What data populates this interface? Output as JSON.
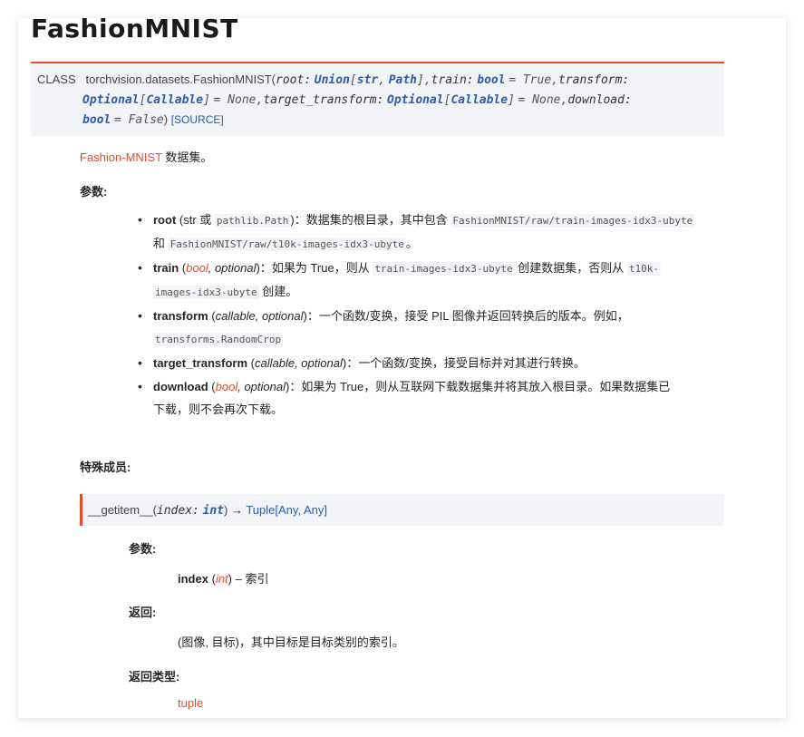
{
  "title": "FashionMNIST",
  "signature": {
    "class_label": "CLASS",
    "class_path": "torchvision.datasets.FashionMNIST(",
    "p_root": "root:",
    "t_union": "Union",
    "lb1": "[",
    "t_str": "str",
    "comma1": ",",
    "t_path": "Path",
    "rb1": "]",
    "sep1": ",",
    "p_train": "train:",
    "t_bool1": "bool",
    "d_true": "= True",
    "sep2": ",",
    "p_transform": "transform:",
    "t_optional1": "Optional",
    "lb2": "[",
    "t_callable1": "Callable",
    "rb2": "]",
    "d_none1": "= None",
    "sep3": ",",
    "p_target": "target_transform:",
    "t_optional2": "Optional",
    "lb3": "[",
    "t_callable2": "Callable",
    "rb3": "]",
    "d_none2": "= None",
    "sep4": ",",
    "p_download": "download:",
    "t_bool2": "bool",
    "d_false": "= False",
    "close": ")",
    "source": "[SOURCE]"
  },
  "description": {
    "link": "Fashion-MNIST",
    "text": "数据集。"
  },
  "params_heading": "参数:",
  "params": {
    "root": {
      "name": "root",
      "open": "(str 或 ",
      "code1": "pathlib.Path",
      "close": ")",
      "desc": "：数据集的根目录，其中包含 ",
      "code2": "FashionMNIST/raw/train-images-idx3-ubyte",
      "and": "和 ",
      "code3": "FashionMNIST/raw/t10k-images-idx3-ubyte",
      "end": "。"
    },
    "train": {
      "name": "train",
      "open": "(",
      "type": "bool",
      "opt": ", optional",
      "close": ")",
      "desc": "：如果为 True，则从 ",
      "code1": "train-images-idx3-ubyte",
      "mid": " 创建数据集，否则从 ",
      "code2a": "t10k-",
      "code2b": "images-idx3-ubyte",
      "end": " 创建。"
    },
    "transform": {
      "name": "transform",
      "open": "(",
      "type": "callable, optional",
      "close": ")",
      "desc": "：一个函数/变换，接受 PIL 图像并返回转换后的版本。例如，",
      "code1": "transforms.RandomCrop"
    },
    "target_transform": {
      "name": "target_transform",
      "open": "(",
      "type": "callable, optional",
      "close": ")",
      "desc": "：一个函数/变换，接受目标并对其进行转换。"
    },
    "download": {
      "name": "download",
      "open": "(",
      "type": "bool",
      "opt": ", optional",
      "close": ")",
      "desc": "：如果为 True，则从互联网下载数据集并将其放入根目录。如果数据集已",
      "desc2": "下载，则不会再次下载。"
    }
  },
  "special_members_heading": "特殊成员:",
  "method": {
    "name": "__getitem__",
    "open": "(",
    "param": "index:",
    "ptype": "int",
    "close": ")",
    "arrow": "→",
    "ret": "Tuple",
    "ret_open": "[",
    "any1": "Any",
    "comma": ", ",
    "any2": "Any",
    "ret_close": "]"
  },
  "method_params_heading": "参数:",
  "method_param": {
    "name": "index",
    "open": "(",
    "type": "int",
    "close": ")",
    "desc": " – 索引"
  },
  "returns_heading": "返回:",
  "returns_text": "(图像, 目标)，其中目标是目标类别的索引。",
  "return_type_heading": "返回类型:",
  "return_type": "tuple"
}
